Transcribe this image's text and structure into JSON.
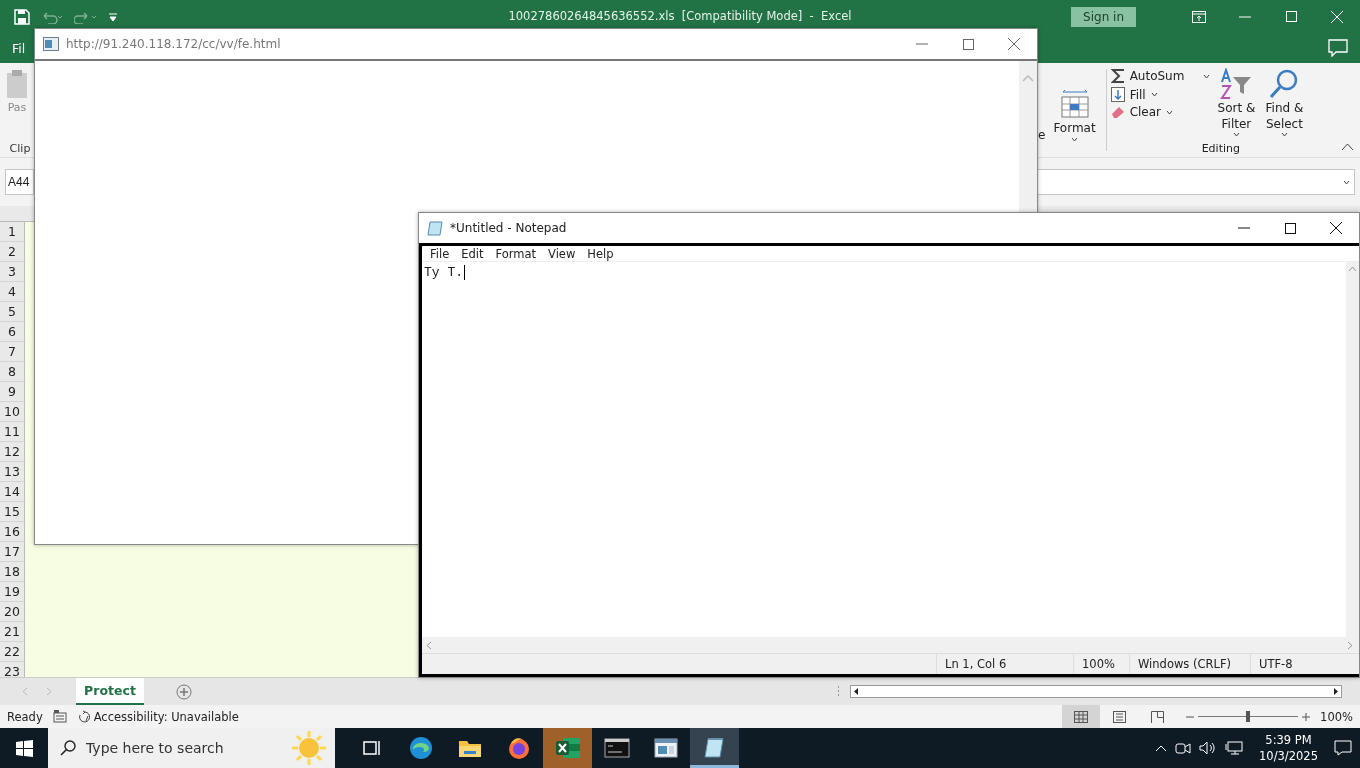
{
  "excel": {
    "title": "10027860264845636552.xls  [Compatibility Mode]  -  Excel",
    "sign_in": "Sign in",
    "file_tab": "Fil",
    "ribbon": {
      "paste": "Pas",
      "clipboard_group": "Clip",
      "delete_cut": "e",
      "format": "Format",
      "autosum": "AutoSum",
      "fill": "Fill",
      "clear": "Clear",
      "sort_filter": "Sort & Filter",
      "find_select": "Find & Select",
      "editing_group": "Editing"
    },
    "name_box": "A44",
    "rows": [
      "1",
      "2",
      "3",
      "4",
      "5",
      "6",
      "7",
      "8",
      "9",
      "10",
      "11",
      "12",
      "13",
      "14",
      "15",
      "16",
      "17",
      "18",
      "19",
      "20",
      "21",
      "22",
      "23"
    ],
    "sheet_tabs": [
      {
        "label": "Protect",
        "selected": true
      }
    ],
    "status_bar": {
      "mode": "Ready",
      "accessibility": "Accessibility: Unavailable",
      "zoom_slider": {
        "level": 0.5
      },
      "zoom": "100%"
    }
  },
  "browser_window": {
    "address": "http://91.240.118.172/cc/vv/fe.html"
  },
  "notepad": {
    "title": "*Untitled - Notepad",
    "menu": [
      "File",
      "Edit",
      "Format",
      "View",
      "Help"
    ],
    "text": "Ty T.",
    "status_bar": {
      "position": "Ln 1, Col 6",
      "zoom": "100%",
      "line_endings": "Windows (CRLF)",
      "encoding": "UTF-8"
    }
  },
  "taskbar": {
    "search_placeholder": "Type here to search",
    "apps": [
      {
        "kind": "taskview",
        "selected": false,
        "attention": false
      },
      {
        "kind": "edge",
        "selected": false,
        "attention": false
      },
      {
        "kind": "explorer",
        "selected": false,
        "attention": false
      },
      {
        "kind": "firefox",
        "selected": false,
        "attention": false
      },
      {
        "kind": "excel",
        "selected": false,
        "attention": true
      },
      {
        "kind": "terminal",
        "selected": false,
        "attention": false
      },
      {
        "kind": "window",
        "selected": false,
        "attention": false
      },
      {
        "kind": "notepad",
        "selected": true,
        "attention": false
      }
    ],
    "time": "5:39 PM",
    "date": "10/3/2025"
  }
}
